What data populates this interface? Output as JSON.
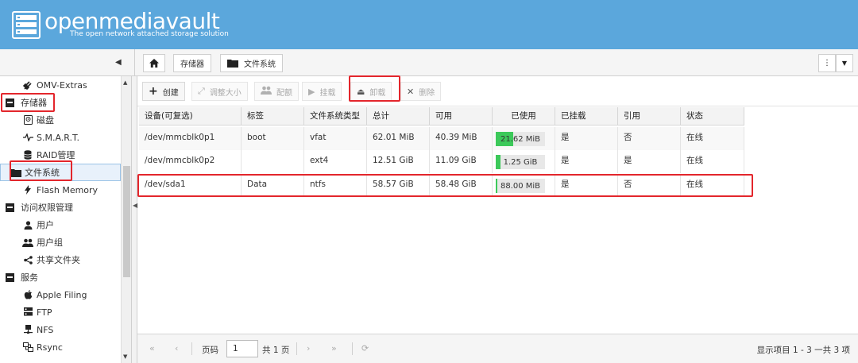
{
  "header": {
    "brand": "openmediavault",
    "tagline": "The open network attached storage solution"
  },
  "sidebar": {
    "items": [
      {
        "label": "OMV-Extras",
        "icon": "plug-icon",
        "level": 1
      },
      {
        "label": "存储器",
        "icon": "collapse-icon",
        "level": 0
      },
      {
        "label": "磁盘",
        "icon": "disk-icon",
        "level": 1
      },
      {
        "label": "S.M.A.R.T.",
        "icon": "pulse-icon",
        "level": 1
      },
      {
        "label": "RAID管理",
        "icon": "database-icon",
        "level": 1
      },
      {
        "label": "文件系统",
        "icon": "folder-icon",
        "level": 1,
        "selected": true
      },
      {
        "label": "Flash Memory",
        "icon": "flash-icon",
        "level": 1
      },
      {
        "label": "访问权限管理",
        "icon": "collapse-icon",
        "level": 0
      },
      {
        "label": "用户",
        "icon": "user-icon",
        "level": 1
      },
      {
        "label": "用户组",
        "icon": "users-icon",
        "level": 1
      },
      {
        "label": "共享文件夹",
        "icon": "share-icon",
        "level": 1
      },
      {
        "label": "服务",
        "icon": "collapse-icon",
        "level": 0
      },
      {
        "label": "Apple Filing",
        "icon": "apple-icon",
        "level": 1
      },
      {
        "label": "FTP",
        "icon": "server-icon",
        "level": 1
      },
      {
        "label": "NFS",
        "icon": "network-icon",
        "level": 1
      },
      {
        "label": "Rsync",
        "icon": "sync-icon",
        "level": 1
      }
    ]
  },
  "breadcrumb": {
    "items": [
      "存储器",
      "文件系统"
    ]
  },
  "toolbar": {
    "create": "创建",
    "resize": "调整大小",
    "quota": "配额",
    "mount": "挂载",
    "unmount": "卸载",
    "delete": "删除"
  },
  "grid": {
    "columns": [
      "设备(可复选)",
      "标签",
      "文件系统类型",
      "总计",
      "可用",
      "已使用",
      "已挂载",
      "引用",
      "状态"
    ],
    "rows": [
      {
        "device": "/dev/mmcblk0p1",
        "label": "boot",
        "fstype": "vfat",
        "total": "62.01 MiB",
        "available": "40.39 MiB",
        "used": "21.62 MiB",
        "used_pct": 35,
        "mounted": "是",
        "referenced": "否",
        "status": "在线"
      },
      {
        "device": "/dev/mmcblk0p2",
        "label": "",
        "fstype": "ext4",
        "total": "12.51 GiB",
        "available": "11.09 GiB",
        "used": "1.25 GiB",
        "used_pct": 10,
        "mounted": "是",
        "referenced": "是",
        "status": "在线"
      },
      {
        "device": "/dev/sda1",
        "label": "Data",
        "fstype": "ntfs",
        "total": "58.57 GiB",
        "available": "58.48 GiB",
        "used": "88.00 MiB",
        "used_pct": 1,
        "mounted": "是",
        "referenced": "否",
        "status": "在线"
      }
    ]
  },
  "paging": {
    "page_label": "页码",
    "page_value": "1",
    "of_pages": "共 1 页",
    "info": "显示项目 1 - 3 一共 3 项"
  },
  "colors": {
    "header_bg": "#5ba7dc",
    "usage_bar": "#3cc95a",
    "annotation_red": "#e3262c"
  }
}
